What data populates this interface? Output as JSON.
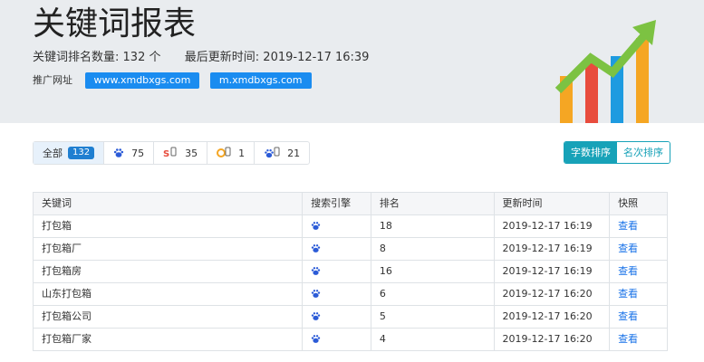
{
  "header": {
    "title": "关键词报表",
    "keyword_count_label": "关键词排名数量:",
    "keyword_count_value": "132 个",
    "last_update_label": "最后更新时间:",
    "last_update_value": "2019-12-17 16:39",
    "promo_label": "推广网址",
    "promo_urls": [
      "www.xmdbxgs.com",
      "m.xmdbxgs.com"
    ]
  },
  "chart_colors": [
    "#f5a623",
    "#e84c3d",
    "#1e9be0",
    "#f5a623",
    "#7cc242"
  ],
  "filters": [
    {
      "label": "全部",
      "count": "132",
      "icon": "none"
    },
    {
      "label": "",
      "count": "75",
      "icon": "baidu-paw-icon"
    },
    {
      "label": "",
      "count": "35",
      "icon": "so360-mobile-icon"
    },
    {
      "label": "",
      "count": "1",
      "icon": "sogou-mobile-icon"
    },
    {
      "label": "",
      "count": "21",
      "icon": "baidu-mobile-icon"
    }
  ],
  "sort": {
    "by_chars": "字数排序",
    "by_rank": "名次排序"
  },
  "table": {
    "headers": [
      "关键词",
      "搜索引擎",
      "排名",
      "更新时间",
      "快照"
    ],
    "rows": [
      {
        "keyword": "打包箱",
        "rank": "18",
        "time": "2019-12-17 16:19",
        "snapshot": "查看"
      },
      {
        "keyword": "打包箱厂",
        "rank": "8",
        "time": "2019-12-17 16:19",
        "snapshot": "查看"
      },
      {
        "keyword": "打包箱房",
        "rank": "16",
        "time": "2019-12-17 16:19",
        "snapshot": "查看"
      },
      {
        "keyword": "山东打包箱",
        "rank": "6",
        "time": "2019-12-17 16:20",
        "snapshot": "查看"
      },
      {
        "keyword": "打包箱公司",
        "rank": "5",
        "time": "2019-12-17 16:20",
        "snapshot": "查看"
      },
      {
        "keyword": "打包箱厂家",
        "rank": "4",
        "time": "2019-12-17 16:20",
        "snapshot": "查看"
      }
    ]
  }
}
